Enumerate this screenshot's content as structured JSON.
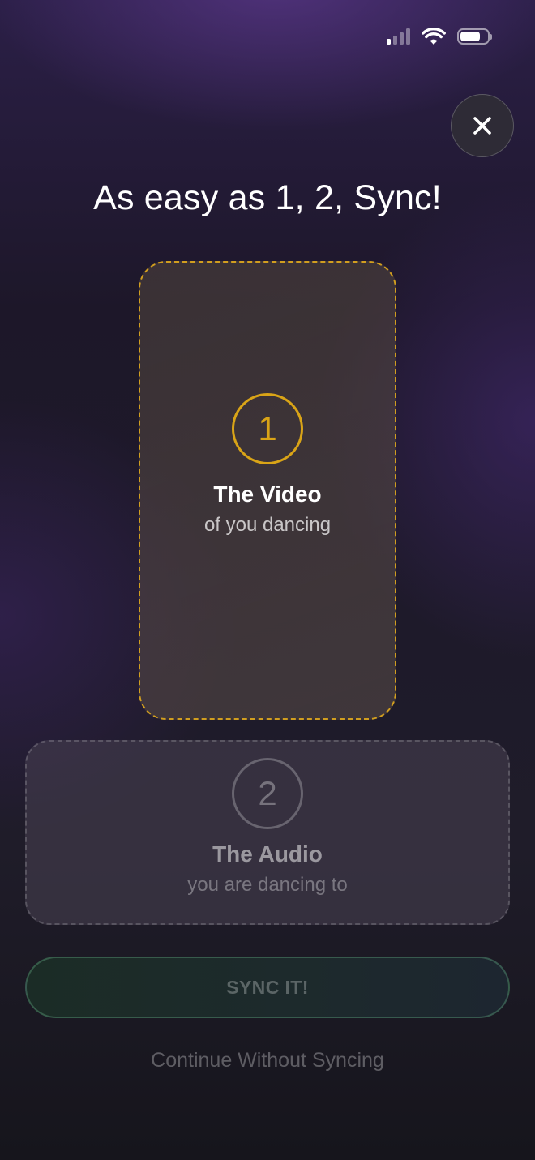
{
  "status_bar": {
    "signal_bars_active": 1,
    "signal_bars_total": 4,
    "battery_level": 0.75,
    "icons": [
      "cellular-signal-icon",
      "wifi-icon",
      "battery-icon"
    ]
  },
  "close_button": {
    "icon": "close-icon"
  },
  "title": "As easy as 1, 2, Sync!",
  "steps": [
    {
      "number": "1",
      "title": "The Video",
      "subtitle": "of you dancing",
      "state": "active",
      "accent": "#d9a417"
    },
    {
      "number": "2",
      "title": "The Audio",
      "subtitle": "you are dancing to",
      "state": "inactive"
    }
  ],
  "sync_button": {
    "label": "SYNC IT!",
    "enabled": false
  },
  "continue_link": {
    "label": "Continue Without Syncing"
  }
}
